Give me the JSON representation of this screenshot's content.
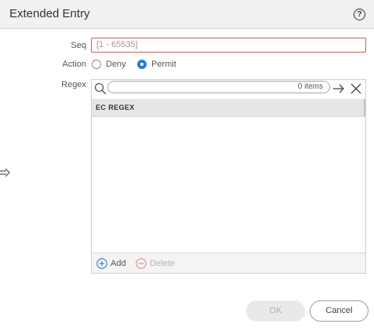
{
  "dialog": {
    "title": "Extended Entry",
    "help_label": "?"
  },
  "form": {
    "seq": {
      "label": "Seq",
      "value": "",
      "placeholder": "[1 - 65535]"
    },
    "action": {
      "label": "Action",
      "options": [
        {
          "label": "Deny",
          "checked": false
        },
        {
          "label": "Permit",
          "checked": true
        }
      ]
    },
    "regex": {
      "label": "Regex",
      "search": {
        "value": "",
        "count_text": "0 items"
      },
      "columns": [
        "EC REGEX"
      ],
      "rows": [],
      "footer": {
        "add_label": "Add",
        "delete_label": "Delete"
      }
    }
  },
  "buttons": {
    "ok_label": "OK",
    "cancel_label": "Cancel"
  },
  "colors": {
    "accent": "#2a7ad5",
    "error_border": "#d05b5b",
    "header_bg": "#f1f1f1"
  },
  "icons": [
    "help-icon",
    "search-icon",
    "arrow-right-icon",
    "close-icon",
    "plus-circle-icon",
    "minus-circle-icon",
    "drag-arrow-icon"
  ]
}
